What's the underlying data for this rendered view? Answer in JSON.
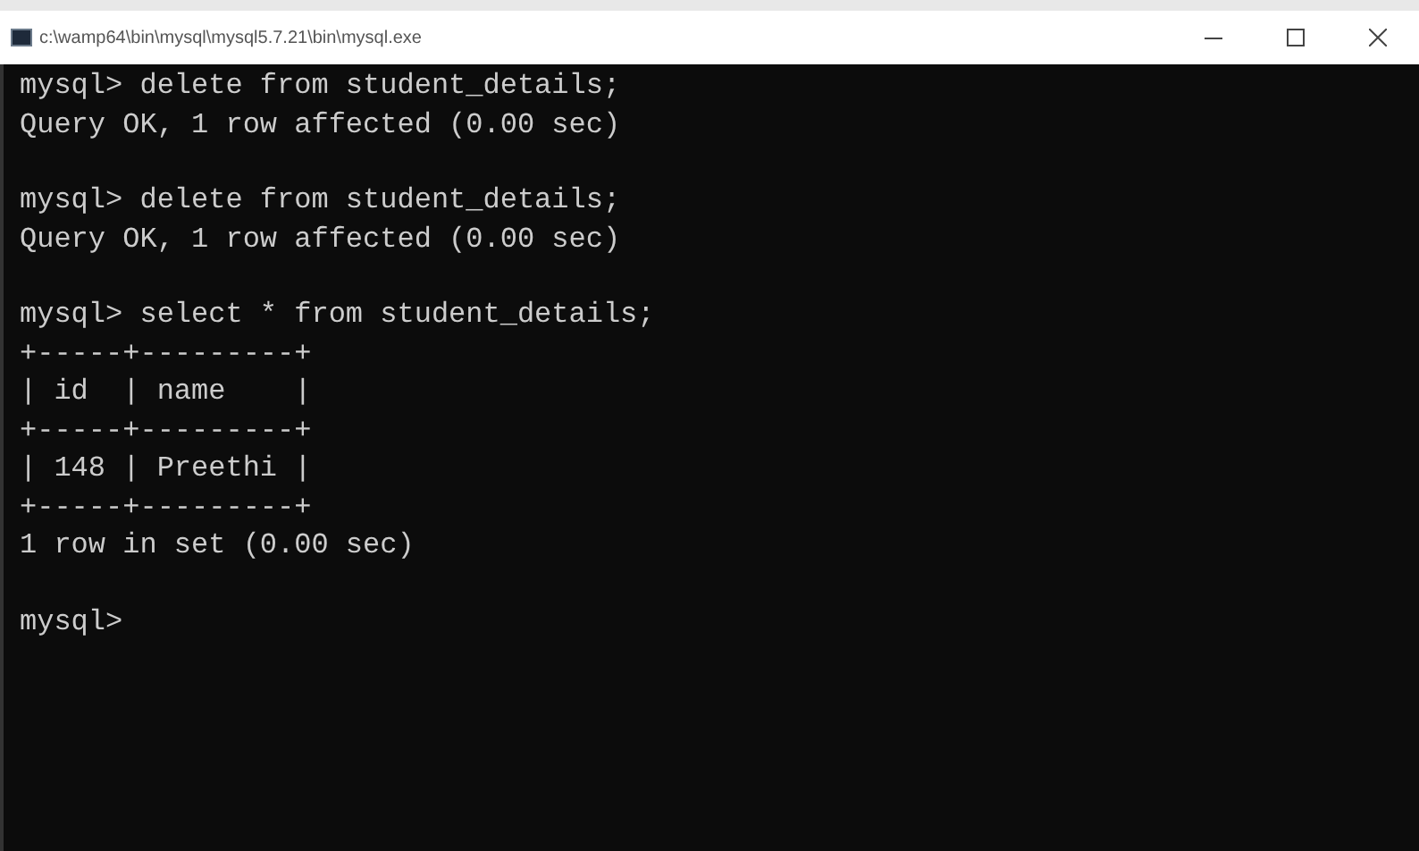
{
  "window": {
    "title": "c:\\wamp64\\bin\\mysql\\mysql5.7.21\\bin\\mysql.exe"
  },
  "console": {
    "blocks": [
      [
        "mysql> delete from student_details;",
        "Query OK, 1 row affected (0.00 sec)"
      ],
      [
        "mysql> delete from student_details;",
        "Query OK, 1 row affected (0.00 sec)"
      ],
      [
        "mysql> select * from student_details;",
        "+-----+---------+",
        "| id  | name    |",
        "+-----+---------+",
        "| 148 | Preethi |",
        "+-----+---------+",
        "1 row in set (0.00 sec)"
      ],
      [
        "mysql>"
      ]
    ]
  }
}
